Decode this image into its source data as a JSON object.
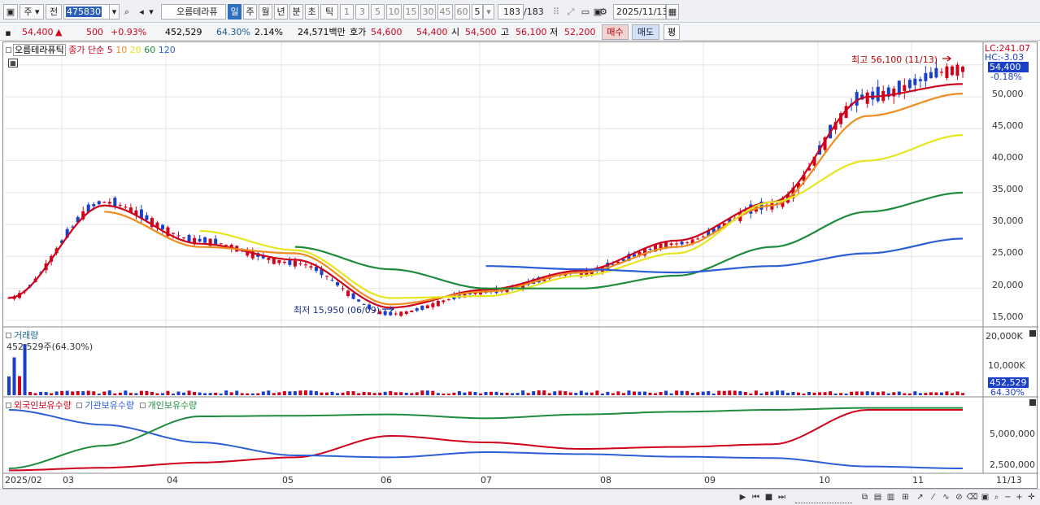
{
  "toolbar": {
    "market": "주",
    "prev": "전",
    "stock_code": "475830",
    "new_tag": "신",
    "stock_name": "오름테라퓨",
    "periods": [
      "일",
      "주",
      "월",
      "년",
      "분",
      "초",
      "틱"
    ],
    "active_period": "일",
    "intervals": [
      "1",
      "3",
      "5",
      "10",
      "15",
      "30",
      "45",
      "60"
    ],
    "interval_value": "5",
    "bar_count": "183",
    "bar_total": "/183",
    "date": "2025/11/13"
  },
  "quote": {
    "price": "54,400",
    "change": "500",
    "change_pct": "+0.93%",
    "volume": "452,529",
    "volume_ratio": "64.30%",
    "turnover": "2.14%",
    "amount": "24,571백만",
    "ask_label": "호가",
    "ask": "54,600",
    "bid": "54,400",
    "open_label": "시",
    "open": "54,500",
    "high_label": "고",
    "high": "56,100",
    "low_label": "저",
    "low": "52,200",
    "buy_label": "매수",
    "sell_label": "매도",
    "avg_label": "평"
  },
  "price_panel": {
    "legend_name": "오름테라퓨틱",
    "legend_type": "종가 단순",
    "ma_periods": [
      "5",
      "10",
      "20",
      "60",
      "120"
    ],
    "ma_colors": [
      "#d0021b",
      "#f08c1e",
      "#e6e61e",
      "#1e8c3c",
      "#2c5fd6"
    ],
    "lc_label": "LC:241.07",
    "hc_label": "HC:-3.03",
    "current_price_tag": "54,400",
    "current_pct_tag": "-0.18%",
    "high_annotation": "최고 56,100 (11/13)",
    "low_annotation": "최저 15,950 (06/09)",
    "y_ticks": [
      "55,000",
      "50,000",
      "45,000",
      "40,000",
      "35,000",
      "30,000",
      "25,000",
      "20,000",
      "15,000"
    ]
  },
  "volume_panel": {
    "legend": "거래량",
    "current_label": "452,529주(64.30%)",
    "y_ticks": [
      "20,000K",
      "10,000K"
    ],
    "current_tag": "452,529",
    "pct_tag": "64.30%"
  },
  "holding_panel": {
    "legend_items": [
      "외국인보유수량",
      "기관보유수량",
      "개인보유수량"
    ],
    "legend_colors": [
      "#d0021b",
      "#2c5fd6",
      "#1e8c3c"
    ],
    "y_ticks": [
      "5,000,000",
      "2,500,000"
    ]
  },
  "x_axis": {
    "labels": [
      "2025/02",
      "03",
      "04",
      "05",
      "06",
      "07",
      "08",
      "09",
      "10",
      "11"
    ],
    "end_label": "11/13"
  },
  "chart_data": {
    "type": "line",
    "title": "오름테라퓨틱",
    "x": [
      "2025/02",
      "03",
      "04",
      "05",
      "06",
      "07",
      "08",
      "09",
      "10",
      "11",
      "11/13"
    ],
    "price_close": [
      18500,
      33500,
      27500,
      24000,
      16000,
      19500,
      22500,
      27000,
      33000,
      50000,
      54400
    ],
    "ma": [
      {
        "name": "5",
        "values": [
          18500,
          33000,
          27000,
          24500,
          17000,
          19800,
          22800,
          27500,
          33500,
          50000,
          52000
        ]
      },
      {
        "name": "10",
        "values": [
          null,
          32000,
          26500,
          25500,
          17500,
          19500,
          22500,
          26500,
          33000,
          47000,
          50500
        ]
      },
      {
        "name": "20",
        "values": [
          null,
          null,
          29000,
          26000,
          18500,
          18800,
          22000,
          25500,
          33500,
          40000,
          44000
        ]
      },
      {
        "name": "60",
        "values": [
          null,
          null,
          null,
          26500,
          23000,
          20000,
          20000,
          22000,
          26500,
          32000,
          35000
        ]
      },
      {
        "name": "120",
        "values": [
          null,
          null,
          null,
          null,
          null,
          23500,
          23000,
          22500,
          23500,
          25500,
          27800
        ]
      }
    ],
    "ylim": [
      15000,
      57000
    ],
    "high": {
      "value": 56100,
      "date": "11/13"
    },
    "low": {
      "value": 15950,
      "date": "06/09"
    },
    "legend_placement": "top-left",
    "grid": true
  }
}
